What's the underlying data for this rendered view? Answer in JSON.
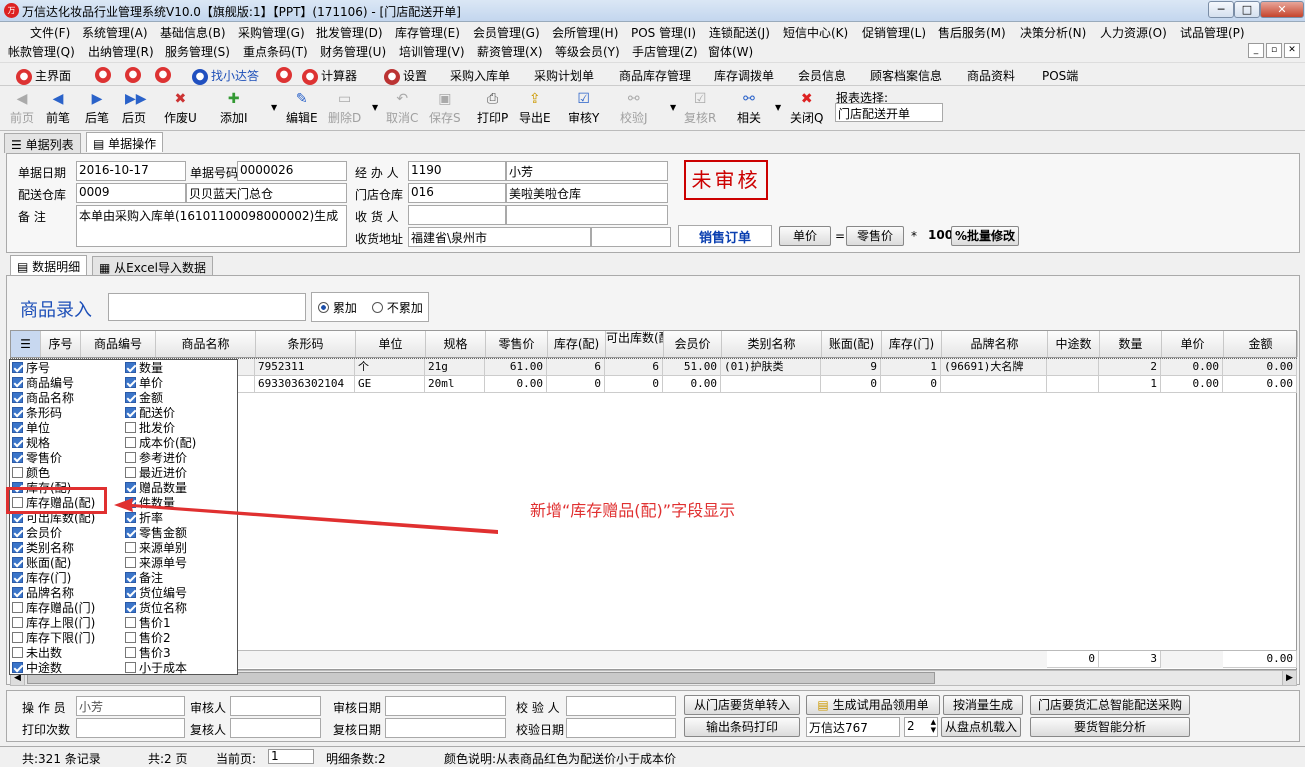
{
  "title": "万信达化妆品行业管理系统V10.0【旗舰版:1】【PPT】(171106) - [门店配送开单]",
  "menu1": [
    "文件(F)",
    "系统管理(A)",
    "基础信息(B)",
    "采购管理(G)",
    "批发管理(D)",
    "库存管理(E)",
    "会员管理(G)",
    "会所管理(H)",
    "POS 管理(I)",
    "连锁配送(J)",
    "短信中心(K)",
    "促销管理(L)",
    "售后服务(M)",
    "决策分析(N)",
    "人力资源(O)",
    "试品管理(P)"
  ],
  "menu2": [
    "帐款管理(Q)",
    "出纳管理(R)",
    "服务管理(S)",
    "重点条码(T)",
    "财务管理(U)",
    "培训管理(V)",
    "薪资管理(X)",
    "等级会员(Y)",
    "手店管理(Z)",
    "窗体(W)"
  ],
  "quick": [
    "主界面",
    "找小达答",
    "计算器",
    "设置",
    "采购入库单",
    "采购计划单",
    "商品库存管理",
    "库存调拨单",
    "会员信息",
    "顾客档案信息",
    "商品资料",
    "POS端"
  ],
  "toolbar": [
    "前页",
    "前笔",
    "后笔",
    "后页",
    "作废U",
    "添加I",
    "编辑E",
    "删除D",
    "取消C",
    "保存S",
    "打印P",
    "导出E",
    "审核Y",
    "校验J",
    "复核R",
    "相关",
    "关闭Q"
  ],
  "report_label": "报表选择:",
  "report_value": "门店配送开单",
  "tabs": [
    "单据列表",
    "单据操作"
  ],
  "form": {
    "date_label": "单据日期",
    "date": "2016-10-17",
    "no_label": "单据号码",
    "no": "0000026",
    "handler_label": "经 办 人",
    "handler_code": "1190",
    "handler_name": "小芳",
    "dist_label": "配送仓库",
    "dist_code": "0009",
    "dist_name": "贝贝蓝天门总仓",
    "store_label": "门店仓库",
    "store_code": "016",
    "store_name": "美啦美啦仓库",
    "remark_label": "备    注",
    "remark": "本单由采购入库单(16101100098000002)生成",
    "receiver_label": "收 货 人",
    "addr_label": "收货地址",
    "addr": "福建省\\泉州市",
    "status": "未审核",
    "order_type": "销售订单",
    "price_btn": "单价",
    "eq": "=",
    "retail_btn": "零售价",
    "mul": "*",
    "factor": "100",
    "batch_btn": "%批量修改"
  },
  "subtabs": [
    "数据明细",
    "从Excel导入数据"
  ],
  "entry_label": "商品录入",
  "radio_add": "累加",
  "radio_noadd": "不累加",
  "columns": [
    "序号",
    "商品编号",
    "商品名称",
    "条形码",
    "单位",
    "规格",
    "零售价",
    "库存(配)",
    "可出库数(配)",
    "会员价",
    "类别名称",
    "账面(配)",
    "库存(门)",
    "品牌名称",
    "中途数",
    "数量",
    "单价",
    "金额"
  ],
  "rows": [
    {
      "part": "",
      "barcode": "7952311",
      "unit": "个",
      "spec": "21g",
      "retail": "61.00",
      "stock": "6",
      "avail": "6",
      "member": "51.00",
      "cat": "(01)护肤类",
      "book": "9",
      "stockm": "1",
      "brand": "(96691)大名牌",
      "transit": "",
      "qty": "2",
      "price": "0.00",
      "amt": "0.00"
    },
    {
      "part": ".2",
      "barcode": "6933036302104",
      "unit": "GE",
      "spec": "20ml",
      "retail": "0.00",
      "stock": "0",
      "avail": "0",
      "member": "0.00",
      "cat": "",
      "book": "0",
      "stockm": "0",
      "brand": "",
      "transit": "",
      "qty": "1",
      "price": "0.00",
      "amt": "0.00"
    }
  ],
  "colpop_left": [
    {
      "t": "序号",
      "c": true
    },
    {
      "t": "商品编号",
      "c": true
    },
    {
      "t": "商品名称",
      "c": true
    },
    {
      "t": "条形码",
      "c": true
    },
    {
      "t": "单位",
      "c": true
    },
    {
      "t": "规格",
      "c": true
    },
    {
      "t": "零售价",
      "c": true
    },
    {
      "t": "颜色",
      "c": false
    },
    {
      "t": "库存(配)",
      "c": true
    },
    {
      "t": "库存赠品(配)",
      "c": false
    },
    {
      "t": "可出库数(配)",
      "c": true
    },
    {
      "t": "会员价",
      "c": true
    },
    {
      "t": "类别名称",
      "c": true
    },
    {
      "t": "账面(配)",
      "c": true
    },
    {
      "t": "库存(门)",
      "c": true
    },
    {
      "t": "品牌名称",
      "c": true
    },
    {
      "t": "库存赠品(门)",
      "c": false
    },
    {
      "t": "库存上限(门)",
      "c": false
    },
    {
      "t": "库存下限(门)",
      "c": false
    },
    {
      "t": "未出数",
      "c": false
    },
    {
      "t": "中途数",
      "c": true
    }
  ],
  "colpop_right": [
    {
      "t": "数量",
      "c": true
    },
    {
      "t": "单价",
      "c": true
    },
    {
      "t": "金额",
      "c": true
    },
    {
      "t": "配送价",
      "c": true
    },
    {
      "t": "批发价",
      "c": false
    },
    {
      "t": "成本价(配)",
      "c": false
    },
    {
      "t": "参考进价",
      "c": false
    },
    {
      "t": "最近进价",
      "c": false
    },
    {
      "t": "赠品数量",
      "c": true
    },
    {
      "t": "件数量",
      "c": true
    },
    {
      "t": "折率",
      "c": true
    },
    {
      "t": "零售金额",
      "c": true
    },
    {
      "t": "来源单别",
      "c": false
    },
    {
      "t": "来源单号",
      "c": false
    },
    {
      "t": "备注",
      "c": true
    },
    {
      "t": "货位编号",
      "c": true
    },
    {
      "t": "货位名称",
      "c": true
    },
    {
      "t": "售价1",
      "c": false
    },
    {
      "t": "售价2",
      "c": false
    },
    {
      "t": "售价3",
      "c": false
    },
    {
      "t": "小于成本",
      "c": false
    }
  ],
  "annotation": "新增“库存赠品(配)”字段显示",
  "sums": {
    "transit": "0",
    "qty": "3",
    "amt": "0.00"
  },
  "bottom": {
    "op_label": "操 作 员",
    "op": "小芳",
    "aud_label": "审核人",
    "auddate_label": "审核日期",
    "chk_label": "校 验 人",
    "print_label": "打印次数",
    "rev_label": "复核人",
    "revdate_label": "复核日期",
    "chkdate_label": "校验日期",
    "b1": "从门店要货单转入",
    "b2": "生成试用品领用单",
    "b3": "按消量生成",
    "b4": "门店要货汇总智能配送采购",
    "b5": "输出条码打印",
    "combo": "万信达767",
    "spin": "2",
    "b6": "从盘点机载入",
    "b7": "要货智能分析"
  },
  "status": {
    "total": "共:321 条记录",
    "pages": "共:2 页",
    "cur_label": "当前页:",
    "cur": "1",
    "detail": "明细条数:2",
    "legend": "颜色说明:从表商品红色为配送价小于成本价"
  }
}
